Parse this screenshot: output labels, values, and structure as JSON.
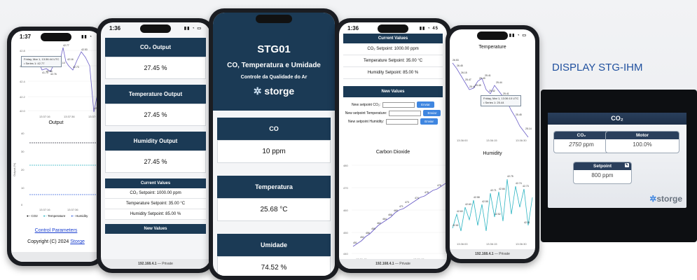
{
  "display_title": "DISPLAY STG-IHM",
  "phone1": {
    "time": "1:37",
    "tooltip_line1": "Friday, Mar 1, 13:36:44 UTC",
    "tooltip_line2": "• Series 1: 42.77",
    "chart1_labels": [
      "42.79",
      "42.77",
      "43.00",
      "41.74",
      "41.86",
      "42.76",
      "43.04",
      "43.14",
      "42.77",
      "42.16",
      "42.73",
      "42.53",
      "42.00"
    ],
    "chart1_yticks": [
      "42.8",
      "42.6",
      "42.4",
      "42.2",
      "42.0"
    ],
    "chart1_xticks": [
      "13:37:16",
      "13:37:36",
      "13:37:"
    ],
    "chart2_title": "Output",
    "chart2_yticks": [
      "40",
      "30",
      "20",
      "10",
      "0"
    ],
    "chart2_ylabel": "Output (%)",
    "chart2_xticks": [
      "13:37:16",
      "13:37:36"
    ],
    "legend": [
      "CO2",
      "Temperature",
      "Humidity"
    ],
    "link": "Control Parameters",
    "copyright_pre": "Copyright (C) 2024 ",
    "copyright_brand": "Storge"
  },
  "phone2": {
    "time": "1:36",
    "cards": [
      {
        "title": "CO₂ Output",
        "value": "27.45 %"
      },
      {
        "title": "Temperature Output",
        "value": "27.45 %"
      },
      {
        "title": "Humidity Output",
        "value": "27.45 %"
      }
    ],
    "current_title": "Current Values",
    "rows": [
      "CO₂ Setpoint: 1000.00 ppm",
      "Temperature Setpoint: 35.00 °C",
      "Humidity Setpoint: 85.00 %"
    ],
    "new_title": "New Values",
    "foot": "192.168.4.1",
    "foot_suffix": " — Private"
  },
  "phone3": {
    "title": "STG01",
    "subtitle": "CO, Temperatura e Umidade",
    "sub2": "Controle da Qualidade do Ar",
    "brand": "storge",
    "cards": [
      {
        "title": "CO",
        "value": "10 ppm"
      },
      {
        "title": "Temperatura",
        "value": "25.68 °C"
      },
      {
        "title": "Umidade",
        "value": "74.52 %"
      }
    ]
  },
  "phone4": {
    "time": "1:36",
    "battery": "45",
    "current_title": "Current Values",
    "rows": [
      "CO₂ Setpoint: 1000.00 ppm",
      "Temperature Setpoint: 35.00 °C",
      "Humidity Setpoint: 85.00 %"
    ],
    "new_title": "New Values",
    "inputs": [
      "New setpoint CO₂:",
      "New setpoint Temperature:",
      "New setpoint Humidity:"
    ],
    "btn": "Enviar",
    "chart_title": "Carbon Dioxide",
    "yticks": [
      "480",
      "470",
      "460",
      "450",
      "440"
    ],
    "xticks": [
      "13:36:45",
      "13:36:15"
    ],
    "labels": [
      "451",
      "452",
      "456",
      "459",
      "462",
      "464",
      "466",
      "469",
      "471",
      "473",
      "474",
      "475",
      "478"
    ],
    "foot": "192.168.4.1",
    "foot_suffix": " — Private"
  },
  "phone5": {
    "chart1_title": "Temperature",
    "t_labels": [
      "26.53",
      "26.45",
      "26.15",
      "25.47",
      "25.41",
      "25.45",
      "25.49",
      "25.41",
      "25.42",
      "25.44",
      "25.41",
      "25.45",
      "25.14"
    ],
    "tooltip_line1": "Friday, Mar 1, 13:36:10 UTC",
    "tooltip_line2": "• Series 1: 25.44",
    "chart2_title": "Humidity",
    "h_labels": [
      "42.75",
      "42.74",
      "42.73",
      "42.71",
      "42.66",
      "42.63",
      "42.61",
      "42.60",
      "42.58",
      "42.55",
      "42.52",
      "42.51"
    ],
    "xticks": [
      "13:36:00",
      "13:36:15",
      "13:36:30"
    ],
    "foot": "192.168.4.1",
    "foot_suffix": " — Private"
  },
  "hmi": {
    "header": "CO₂",
    "co2_label": "CO₂",
    "co2_value": "2750",
    "co2_unit": "ppm",
    "motor_label": "Motor",
    "motor_value": "100.0%",
    "setpoint_label": "Setpoint",
    "setpoint_value": "800",
    "setpoint_unit": "ppm",
    "brand": "storge"
  },
  "colors": {
    "navy": "#1b3a55",
    "accent": "#3f86e0",
    "line": "#6c5fc7",
    "cyan": "#2bb4c2"
  }
}
